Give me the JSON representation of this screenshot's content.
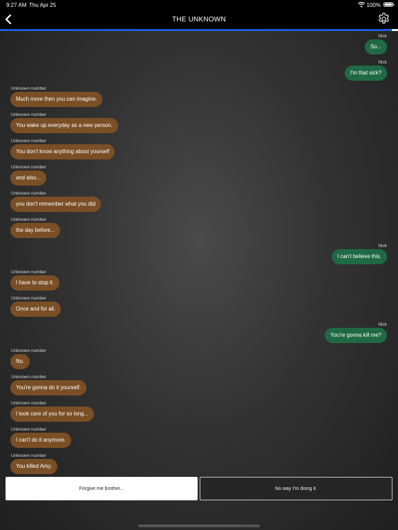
{
  "status": {
    "time": "9:27 AM",
    "date": "Thu Apr 25",
    "battery": "100%"
  },
  "nav": {
    "title": "THE UNKNOWN"
  },
  "progress": 0.985,
  "messages": [
    {
      "side": "out",
      "sender": "Nick",
      "text": "So..."
    },
    {
      "side": "out",
      "sender": "Nick",
      "text": "I'm that sick?"
    },
    {
      "side": "in",
      "sender": "Unknown number",
      "text": "Much more then you can imagine."
    },
    {
      "side": "in",
      "sender": "Unknown number",
      "text": "You wake up everyday as a new person."
    },
    {
      "side": "in",
      "sender": "Unknown number",
      "text": "You don't know anything about yourself"
    },
    {
      "side": "in",
      "sender": "Unknown number",
      "text": "and also..."
    },
    {
      "side": "in",
      "sender": "Unknown number",
      "text": "you don't remember what you did"
    },
    {
      "side": "in",
      "sender": "Unknown number",
      "text": "the day before..."
    },
    {
      "side": "out",
      "sender": "Nick",
      "text": "I can't believe this."
    },
    {
      "side": "in",
      "sender": "Unknown number",
      "text": "I have to stop it."
    },
    {
      "side": "in",
      "sender": "Unknown number",
      "text": "Once and for all."
    },
    {
      "side": "out",
      "sender": "Nick",
      "text": "You're gonna kill me?"
    },
    {
      "side": "in",
      "sender": "Unknown number",
      "text": "No."
    },
    {
      "side": "in",
      "sender": "Unknown number",
      "text": "You're gonna do it yourself."
    },
    {
      "side": "in",
      "sender": "Unknown number",
      "text": "I took care of you for so long..."
    },
    {
      "side": "in",
      "sender": "Unknown number",
      "text": "I can't do it anymore."
    },
    {
      "side": "in",
      "sender": "Unknown number",
      "text": "You killed Amy."
    }
  ],
  "choices": {
    "left": "Forgive me brother...",
    "right": "No way I'm doing it."
  },
  "icons": {
    "back": "chevron-left-icon",
    "settings": "gear-icon",
    "wifi": "wifi-icon",
    "battery": "battery-icon"
  },
  "colors": {
    "incoming_bubble": "#7a4f26",
    "outgoing_bubble": "#1f6a45",
    "progress": "#1c5bd6"
  }
}
